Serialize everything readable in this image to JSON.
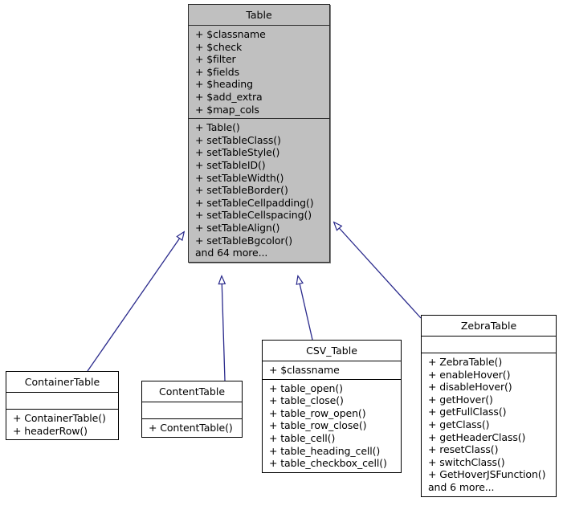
{
  "diagram": {
    "type": "uml-class-inheritance",
    "title": "Table class hierarchy",
    "background_color": "#ffffff",
    "edge_color": "#2a2a8c",
    "base_fill_color": "#c0c0c0",
    "derived_fill_color": "#ffffff",
    "border_color": "#000000"
  },
  "nodes": {
    "table": {
      "name": "Table",
      "attributes": [
        "+ $classname",
        "+ $check",
        "+ $filter",
        "+ $fields",
        "+ $heading",
        "+ $add_extra",
        "+ $map_cols"
      ],
      "methods": [
        "+ Table()",
        "+ setTableClass()",
        "+ setTableStyle()",
        "+ setTableID()",
        "+ setTableWidth()",
        "+ setTableBorder()",
        "+ setTableCellpadding()",
        "+ setTableCellspacing()",
        "+ setTableAlign()",
        "+ setTableBgcolor()",
        "and 64 more..."
      ]
    },
    "container_table": {
      "name": "ContainerTable",
      "attributes": [],
      "methods": [
        "+ ContainerTable()",
        "+ headerRow()"
      ]
    },
    "content_table": {
      "name": "ContentTable",
      "attributes": [],
      "methods": [
        "+ ContentTable()"
      ]
    },
    "csv_table": {
      "name": "CSV_Table",
      "attributes": [
        "+ $classname"
      ],
      "methods": [
        "+ table_open()",
        "+ table_close()",
        "+ table_row_open()",
        "+ table_row_close()",
        "+ table_cell()",
        "+ table_heading_cell()",
        "+ table_checkbox_cell()"
      ]
    },
    "zebra_table": {
      "name": "ZebraTable",
      "attributes": [],
      "methods": [
        "+ ZebraTable()",
        "+ enableHover()",
        "+ disableHover()",
        "+ getHover()",
        "+ getFullClass()",
        "+ getClass()",
        "+ getHeaderClass()",
        "+ resetClass()",
        "+ switchClass()",
        "+ GetHoverJSFunction()",
        "and 6 more..."
      ]
    }
  },
  "edges": [
    {
      "from": "container_table",
      "to": "table",
      "relation": "generalization"
    },
    {
      "from": "content_table",
      "to": "table",
      "relation": "generalization"
    },
    {
      "from": "csv_table",
      "to": "table",
      "relation": "generalization"
    },
    {
      "from": "zebra_table",
      "to": "table",
      "relation": "generalization"
    }
  ]
}
